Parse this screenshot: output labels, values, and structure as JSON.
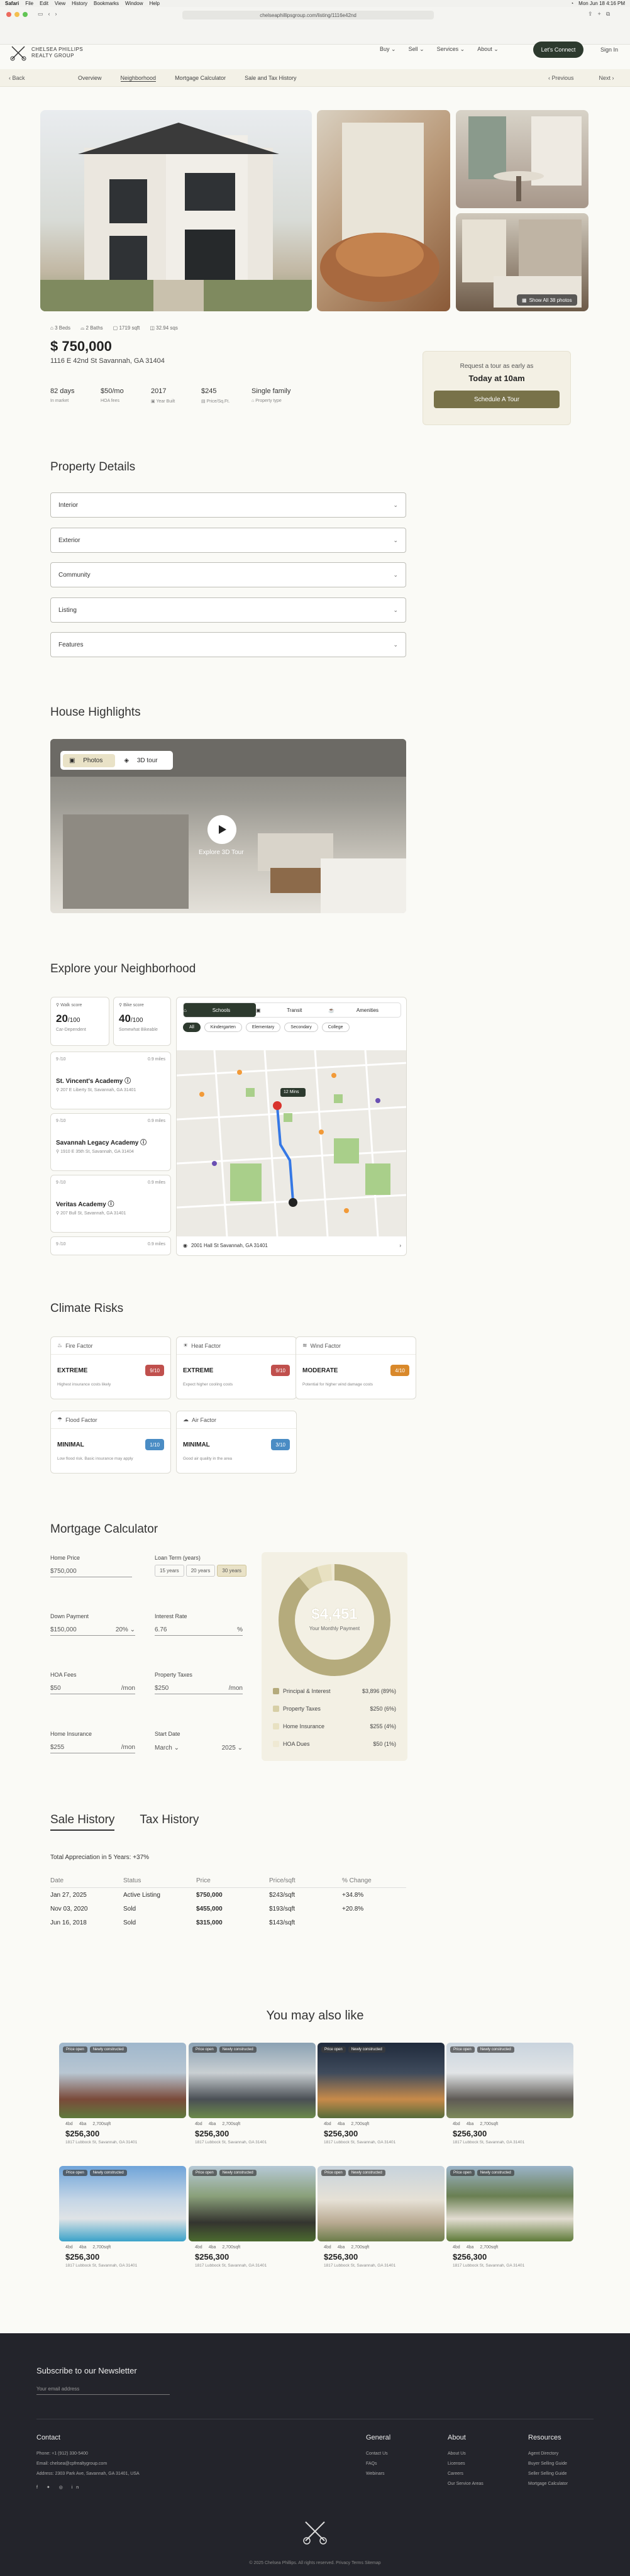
{
  "menubar": {
    "app": "Safari",
    "items": [
      "File",
      "Edit",
      "View",
      "History",
      "Bookmarks",
      "Window",
      "Help"
    ],
    "clock": "Mon Jun 18 4:16 PM"
  },
  "browser": {
    "url": "chelseaphillipsgroup.com/listing/1116e42nd"
  },
  "brand": {
    "line1": "CHELSEA PHILLIPS",
    "line2": "REALTY GROUP"
  },
  "topnav": {
    "items": [
      "Buy",
      "Sell",
      "Services",
      "About"
    ],
    "connect": "Let's Connect",
    "signin": "Sign In"
  },
  "subnav": {
    "back": "Back",
    "links": [
      "Overview",
      "Neighborhood",
      "Mortgage Calculator",
      "Sale and Tax History"
    ],
    "prev": "Previous",
    "next": "Next"
  },
  "gallery": {
    "show_all": "Show All 38 photos"
  },
  "listing": {
    "facts": [
      "3 Beds",
      "2 Baths",
      "1719 sqft",
      "32.94 sqs"
    ],
    "price": "$ 750,000",
    "address": "1116 E 42nd St Savannah, GA 31404",
    "stats": [
      {
        "value": "82 days",
        "label": "In market"
      },
      {
        "value": "$50/mo",
        "label": "HOA fees"
      },
      {
        "value": "2017",
        "label": "Year Built"
      },
      {
        "value": "$245",
        "label": "Price/Sq.Ft."
      },
      {
        "value": "Single family",
        "label": "Property type"
      }
    ]
  },
  "tour": {
    "line1": "Request a tour as early as",
    "line2": "Today at 10am",
    "button": "Schedule A Tour"
  },
  "details": {
    "title": "Property Details",
    "items": [
      "Interior",
      "Exterior",
      "Community",
      "Listing",
      "Features"
    ]
  },
  "highlights": {
    "title": "House Highlights",
    "tab_photos": "Photos",
    "tab_3d": "3D tour",
    "explore": "Explore 3D Tour"
  },
  "neighborhood": {
    "title": "Explore your Neighborhood",
    "walk": {
      "label": "Walk score",
      "value": "20",
      "max": "/100",
      "sub": "Car-Dependent"
    },
    "bike": {
      "label": "Bike score",
      "value": "40",
      "max": "/100",
      "sub": "Somewhat Bikeable"
    },
    "schools": [
      {
        "rating": "9 /10",
        "dist": "0.9 miles",
        "name": "St. Vincent's Academy",
        "addr": "207 E Liberty St, Savannah, GA 31401"
      },
      {
        "rating": "9 /10",
        "dist": "0.9 miles",
        "name": "Savannah Legacy Academy",
        "addr": "1910 E 35th St, Savannah, GA 31404"
      },
      {
        "rating": "9 /10",
        "dist": "0.9 miles",
        "name": "Veritas Academy",
        "addr": "207 Bull St, Savannah, GA 31401"
      },
      {
        "rating": "9 /10",
        "dist": "0.9 miles"
      }
    ],
    "map_tabs": [
      "Schools",
      "Transit",
      "Amenities"
    ],
    "chips": [
      "All",
      "Kindergarten",
      "Elementary",
      "Secondary",
      "College"
    ],
    "map_address": "2001 Hall St Savannah, GA 31401",
    "pin_label": "12 Mins"
  },
  "climate": {
    "title": "Climate Risks",
    "items": [
      {
        "name": "Fire Factor",
        "level": "EXTREME",
        "score": "9/10",
        "desc": "Highest insurance costs likely",
        "color": "#c0504d"
      },
      {
        "name": "Heat Factor",
        "level": "EXTREME",
        "score": "9/10",
        "desc": "Expect higher cooling costs",
        "color": "#c0504d"
      },
      {
        "name": "Wind Factor",
        "level": "MODERATE",
        "score": "4/10",
        "desc": "Potential for higher wind damage costs",
        "color": "#d9892b"
      },
      {
        "name": "Flood Factor",
        "level": "MINIMAL",
        "score": "1/10",
        "desc": "Low flood risk. Basic insurance may apply",
        "color": "#4a8cc4"
      },
      {
        "name": "Air Factor",
        "level": "MINIMAL",
        "score": "3/10",
        "desc": "Good air quality in the area",
        "color": "#4a8cc4"
      }
    ]
  },
  "mortgage": {
    "title": "Mortgage Calculator",
    "home_price": {
      "label": "Home Price",
      "value": "$750,000"
    },
    "loan_term": {
      "label": "Loan Term (years)",
      "options": [
        "15 years",
        "20 years",
        "30 years"
      ]
    },
    "down_payment": {
      "label": "Down Payment",
      "value": "$150,000",
      "pct": "20%"
    },
    "interest": {
      "label": "Interest Rate",
      "value": "6.76",
      "unit": "%"
    },
    "hoa": {
      "label": "HOA Fees",
      "value": "$50",
      "unit": "/mon"
    },
    "tax": {
      "label": "Property Taxes",
      "value": "$250",
      "unit": "/mon"
    },
    "insurance": {
      "label": "Home Insurance",
      "value": "$255",
      "unit": "/mon"
    },
    "start": {
      "label": "Start Date",
      "month": "March",
      "year": "2025"
    },
    "monthly": "$4,451",
    "monthly_label": "Your Monthly Payment",
    "breakdown": [
      {
        "name": "Principal & Interest",
        "value": "$3,896 (89%)",
        "color": "#b5ab7c",
        "share": 0.89
      },
      {
        "name": "Property Taxes",
        "value": "$250 (6%)",
        "color": "#d7cfa6",
        "share": 0.06
      },
      {
        "name": "Home Insurance",
        "value": "$255 (4%)",
        "color": "#e8e1c2",
        "share": 0.04
      },
      {
        "name": "HOA Dues",
        "value": "$50 (1%)",
        "color": "#efe9d3",
        "share": 0.01
      }
    ]
  },
  "history": {
    "tab_sale": "Sale History",
    "tab_tax": "Tax History",
    "appreciation": "Total Appreciation in 5 Years: +37%",
    "headers": [
      "Date",
      "Status",
      "Price",
      "Price/sqft",
      "% Change"
    ],
    "rows": [
      [
        "Jan 27, 2025",
        "Active Listing",
        "$750,000",
        "$243/sqft",
        "+34.8%"
      ],
      [
        "Nov 03, 2020",
        "Sold",
        "$455,000",
        "$193/sqft",
        "+20.8%"
      ],
      [
        "Jun 16, 2018",
        "Sold",
        "$315,000",
        "$143/sqft",
        ""
      ]
    ]
  },
  "similar": {
    "title": "You may also like",
    "tags": [
      "Price open",
      "Newly constructed"
    ],
    "facts": [
      "4bd",
      "4ba",
      "2,700sqft"
    ],
    "price": "$256,300",
    "addr": "1817 Lubbock St, Savannah, GA 31401"
  },
  "footer": {
    "subscribe": "Subscribe to our Newsletter",
    "email_placeholder": "Your email address",
    "contact_title": "Contact",
    "contact": [
      "Phone: +1 (912) 330-5400",
      "Email: chelsea@cpfrealtygroup.com",
      "Address: 2303 Park Ave, Savannah, GA 31401, USA"
    ],
    "general_title": "General",
    "general": [
      "Contact Us",
      "FAQs",
      "Webinars"
    ],
    "about_title": "About",
    "about": [
      "About Us",
      "Licenses",
      "Careers",
      "Our Service Areas"
    ],
    "resources_title": "Resources",
    "resources": [
      "Agent Directory",
      "Buyer Selling Guide",
      "Seller Selling Guide",
      "Mortgage Calculator"
    ],
    "copyright": "© 2025 Chelsea Phillips. All rights reserved.  Privacy  Terms  Sitemap"
  }
}
